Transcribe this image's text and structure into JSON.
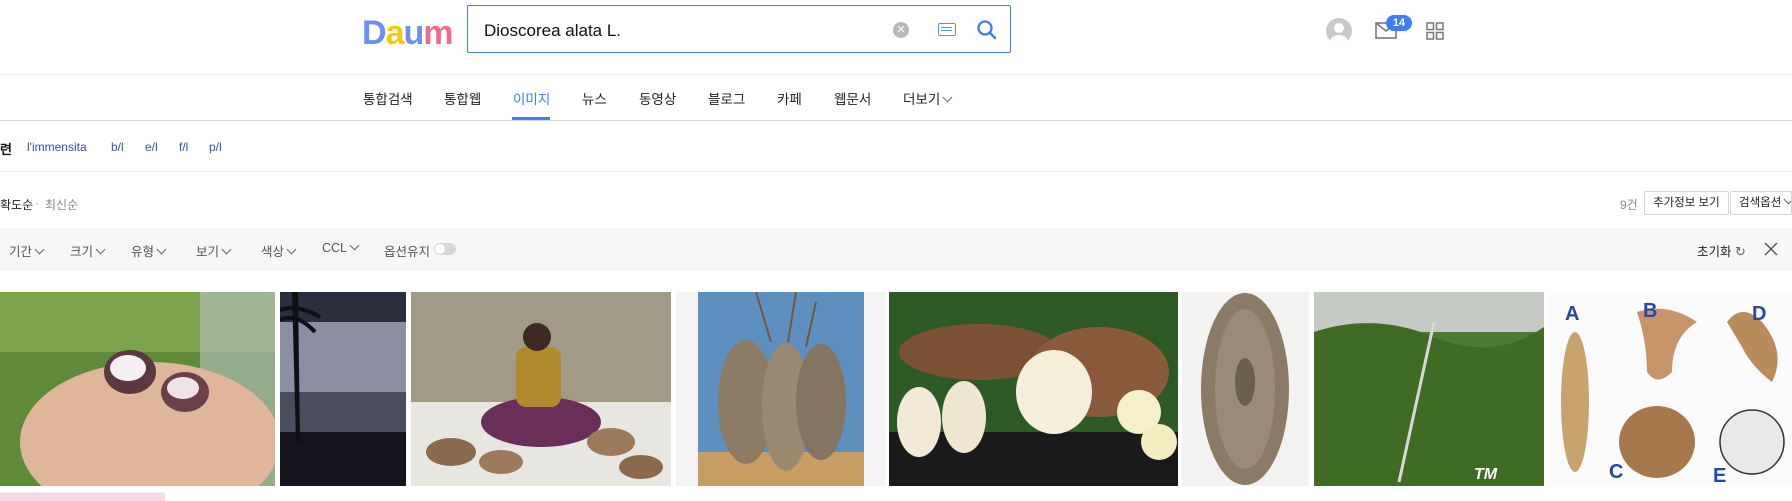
{
  "logo": {
    "letters": [
      "D",
      "a",
      "u",
      "m"
    ],
    "label": "Daum"
  },
  "search": {
    "value": "Dioscorea alata L.",
    "placeholder": ""
  },
  "header": {
    "mail_badge": "14"
  },
  "tabs": [
    {
      "label": "통합검색"
    },
    {
      "label": "통합웹"
    },
    {
      "label": "이미지",
      "active": true
    },
    {
      "label": "뉴스"
    },
    {
      "label": "동영상"
    },
    {
      "label": "블로그"
    },
    {
      "label": "카페"
    },
    {
      "label": "웹문서"
    },
    {
      "label": "더보기"
    }
  ],
  "related": {
    "label": "련",
    "items": [
      "l'immensita",
      "b/l",
      "e/l",
      "f/l",
      "p/l"
    ]
  },
  "sort": {
    "accuracy": "확도순",
    "separator": "·",
    "latest": "최신순",
    "count": "9건",
    "more_info": "추가정보 보기",
    "options": "검색옵션"
  },
  "filters": {
    "items": [
      "기간",
      "크기",
      "유형",
      "보기",
      "색상",
      "CCL"
    ],
    "keep_option": "옵션유지",
    "reset": "초기화"
  },
  "images": [
    {
      "subject": "hand holding purple yam",
      "watermark": ""
    },
    {
      "subject": "palm trees at dusk",
      "watermark": ""
    },
    {
      "subject": "woman selling yams at market",
      "watermark": ""
    },
    {
      "subject": "yam tubers in basket",
      "watermark": ""
    },
    {
      "subject": "sliced yam with flowers",
      "watermark": ""
    },
    {
      "subject": "carved wooden board",
      "watermark": ""
    },
    {
      "subject": "yam vines on trellis",
      "watermark": "TM"
    },
    {
      "subject": "yam tuber shapes labeled",
      "labels": [
        "A",
        "B",
        "D",
        "C",
        "E"
      ]
    }
  ],
  "colors": {
    "accent": "#3d7ef5",
    "link": "#3a48c5"
  }
}
